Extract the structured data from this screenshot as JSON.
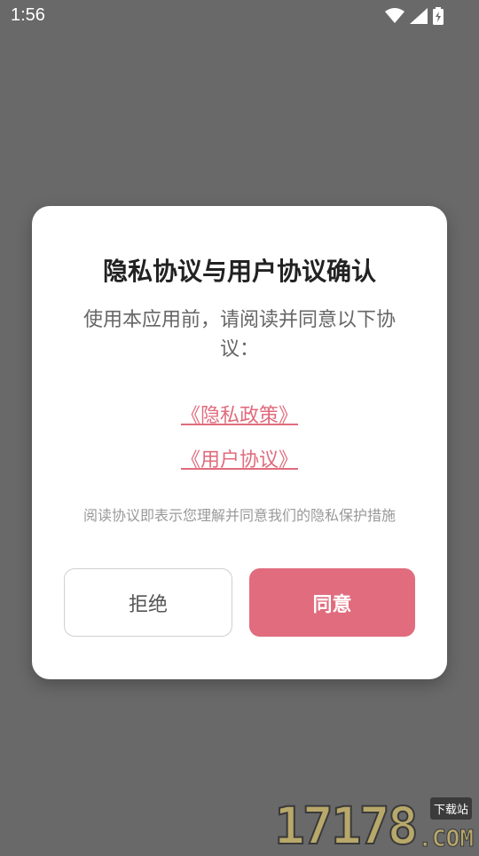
{
  "status_bar": {
    "time": "1:56",
    "icons": [
      "wifi-icon",
      "signal-icon",
      "battery-charging-icon"
    ]
  },
  "dialog": {
    "title": "隐私协议与用户协议确认",
    "subtitle": "使用本应用前，请阅读并同意以下协议：",
    "privacy_link": "《隐私政策》",
    "user_link": "《用户协议》",
    "note": "阅读协议即表示您理解并同意我们的隐私保护措施",
    "reject_label": "拒绝",
    "agree_label": "同意"
  },
  "watermark": {
    "digits": "17178",
    "tag": "下载站",
    "domain": ".COM"
  },
  "colors": {
    "overlay": "#696969",
    "accent": "#e06c7d",
    "title": "#222222",
    "body_text": "#666666",
    "note_text": "#999999"
  }
}
